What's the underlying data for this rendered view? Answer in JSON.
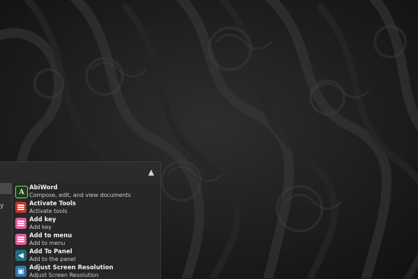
{
  "menu": {
    "collapse_icon": "chevron-up-icon",
    "categories": [
      {
        "label": "",
        "selected": true
      },
      {
        "label": "y",
        "selected": false
      }
    ],
    "apps": [
      {
        "name": "AbiWord",
        "description": "Compose, edit, and view documents",
        "icon": "abiword-icon"
      },
      {
        "name": "Activate Tools",
        "description": "Activate tools",
        "icon": "activate-tools-icon"
      },
      {
        "name": "Add key",
        "description": "Add key",
        "icon": "add-key-icon"
      },
      {
        "name": "Add to menu",
        "description": "Add to menu",
        "icon": "add-to-menu-icon"
      },
      {
        "name": "Add To Panel",
        "description": "Add to the panel",
        "icon": "add-to-panel-icon"
      },
      {
        "name": "Adjust Screen Resolution",
        "description": "Adjust Screen Resolution",
        "icon": "screen-resolution-icon"
      }
    ]
  },
  "colors": {
    "wallpaper": "#1c1c1c",
    "menu_background": "#282828",
    "selected_category": "#4a4a4a"
  }
}
